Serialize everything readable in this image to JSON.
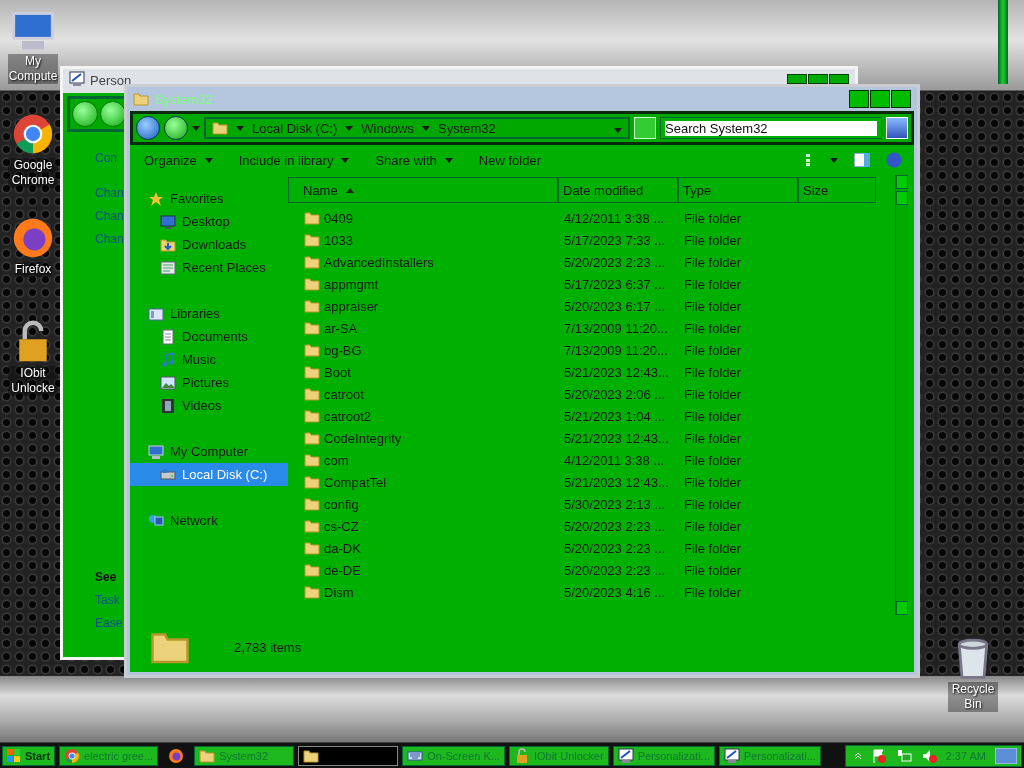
{
  "desktop_icons": [
    {
      "label": "My Compute",
      "kind": "computer"
    },
    {
      "label": "Google Chrome",
      "kind": "chrome"
    },
    {
      "label": "Firefox",
      "kind": "firefox"
    },
    {
      "label": "IObit Unlocke",
      "kind": "lock"
    },
    {
      "label": "Recycle Bin",
      "kind": "bin"
    }
  ],
  "background_window": {
    "title": "Person",
    "links": [
      "Con",
      "Chan",
      "Chan",
      "Chan"
    ],
    "see_also": "See",
    "see_also_links": [
      "Task",
      "Ease"
    ]
  },
  "explorer": {
    "title": "System32",
    "breadcrumbs": [
      "Local Disk (C:)",
      "Windows",
      "System32"
    ],
    "search": {
      "placeholder": "Search System32"
    },
    "toolbar": [
      {
        "label": "Organize",
        "dropdown": true
      },
      {
        "label": "Include in library",
        "dropdown": true
      },
      {
        "label": "Share with",
        "dropdown": true
      },
      {
        "label": "New folder",
        "dropdown": false
      }
    ],
    "navigation": [
      {
        "label": "Favorites",
        "kind": "star",
        "selected": false,
        "children": [
          {
            "label": "Desktop",
            "kind": "desktop",
            "selected": false
          },
          {
            "label": "Downloads",
            "kind": "download",
            "selected": false
          },
          {
            "label": "Recent Places",
            "kind": "recent",
            "selected": false
          }
        ]
      },
      {
        "label": "Libraries",
        "kind": "library",
        "selected": false,
        "children": [
          {
            "label": "Documents",
            "kind": "document",
            "selected": false
          },
          {
            "label": "Music",
            "kind": "music",
            "selected": false
          },
          {
            "label": "Pictures",
            "kind": "picture",
            "selected": false
          },
          {
            "label": "Videos",
            "kind": "video",
            "selected": false
          }
        ]
      },
      {
        "label": "My Computer",
        "kind": "computer",
        "selected": false,
        "children": [
          {
            "label": "Local Disk (C:)",
            "kind": "disk",
            "selected": true
          }
        ]
      },
      {
        "label": "Network",
        "kind": "network",
        "selected": false
      }
    ],
    "columns": [
      {
        "label": "Name",
        "sorted": true
      },
      {
        "label": "Date modified",
        "sorted": false
      },
      {
        "label": "Type",
        "sorted": false
      },
      {
        "label": "Size",
        "sorted": false
      }
    ],
    "rows": [
      {
        "name": "0409",
        "date": "4/12/2011 3:38 ...",
        "type": "File folder"
      },
      {
        "name": "1033",
        "date": "5/17/2023 7:33 ...",
        "type": "File folder"
      },
      {
        "name": "AdvancedInstallers",
        "date": "5/20/2023 2:23 ...",
        "type": "File folder"
      },
      {
        "name": "appmgmt",
        "date": "5/17/2023 6:37 ...",
        "type": "File folder"
      },
      {
        "name": "appraiser",
        "date": "5/20/2023 6:17 ...",
        "type": "File folder"
      },
      {
        "name": "ar-SA",
        "date": "7/13/2009 11:20...",
        "type": "File folder"
      },
      {
        "name": "bg-BG",
        "date": "7/13/2009 11:20...",
        "type": "File folder"
      },
      {
        "name": "Boot",
        "date": "5/21/2023 12:43...",
        "type": "File folder"
      },
      {
        "name": "catroot",
        "date": "5/20/2023 2:06 ...",
        "type": "File folder"
      },
      {
        "name": "catroot2",
        "date": "5/21/2023 1:04 ...",
        "type": "File folder"
      },
      {
        "name": "CodeIntegrity",
        "date": "5/21/2023 12:43...",
        "type": "File folder"
      },
      {
        "name": "com",
        "date": "4/12/2011 3:38 ...",
        "type": "File folder"
      },
      {
        "name": "CompatTel",
        "date": "5/21/2023 12:43...",
        "type": "File folder"
      },
      {
        "name": "config",
        "date": "5/30/2023 2:13 ...",
        "type": "File folder"
      },
      {
        "name": "cs-CZ",
        "date": "5/20/2023 2:23 ...",
        "type": "File folder"
      },
      {
        "name": "da-DK",
        "date": "5/20/2023 2:23 ...",
        "type": "File folder"
      },
      {
        "name": "de-DE",
        "date": "5/20/2023 2:23 ...",
        "type": "File folder"
      },
      {
        "name": "Dism",
        "date": "5/20/2023 4:16 ...",
        "type": "File folder"
      }
    ],
    "status": "2,783 items"
  },
  "taskbar": {
    "start": "Start",
    "tasks": [
      {
        "label": "electric gree...",
        "kind": "chrome"
      },
      {
        "kind": "firefox"
      },
      {
        "label": "System32",
        "kind": "folder"
      },
      {
        "kind": "shaded"
      },
      {
        "label": "On-Screen K...",
        "kind": "keyboard"
      },
      {
        "label": "IObit Unlocker",
        "kind": "lock"
      },
      {
        "label": "Personalizati...",
        "kind": "display"
      },
      {
        "label": "Personalizati...",
        "kind": "display"
      }
    ],
    "clock": "2:37 AM"
  }
}
